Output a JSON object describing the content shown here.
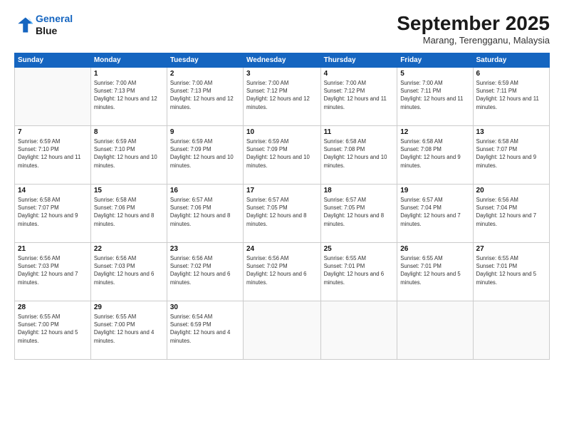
{
  "logo": {
    "line1": "General",
    "line2": "Blue"
  },
  "title": "September 2025",
  "subtitle": "Marang, Terengganu, Malaysia",
  "weekdays": [
    "Sunday",
    "Monday",
    "Tuesday",
    "Wednesday",
    "Thursday",
    "Friday",
    "Saturday"
  ],
  "weeks": [
    [
      {
        "day": "",
        "empty": true
      },
      {
        "day": "1",
        "sunrise": "7:00 AM",
        "sunset": "7:13 PM",
        "daylight": "12 hours and 12 minutes."
      },
      {
        "day": "2",
        "sunrise": "7:00 AM",
        "sunset": "7:13 PM",
        "daylight": "12 hours and 12 minutes."
      },
      {
        "day": "3",
        "sunrise": "7:00 AM",
        "sunset": "7:12 PM",
        "daylight": "12 hours and 12 minutes."
      },
      {
        "day": "4",
        "sunrise": "7:00 AM",
        "sunset": "7:12 PM",
        "daylight": "12 hours and 11 minutes."
      },
      {
        "day": "5",
        "sunrise": "7:00 AM",
        "sunset": "7:11 PM",
        "daylight": "12 hours and 11 minutes."
      },
      {
        "day": "6",
        "sunrise": "6:59 AM",
        "sunset": "7:11 PM",
        "daylight": "12 hours and 11 minutes."
      }
    ],
    [
      {
        "day": "7",
        "sunrise": "6:59 AM",
        "sunset": "7:10 PM",
        "daylight": "12 hours and 11 minutes."
      },
      {
        "day": "8",
        "sunrise": "6:59 AM",
        "sunset": "7:10 PM",
        "daylight": "12 hours and 10 minutes."
      },
      {
        "day": "9",
        "sunrise": "6:59 AM",
        "sunset": "7:09 PM",
        "daylight": "12 hours and 10 minutes."
      },
      {
        "day": "10",
        "sunrise": "6:59 AM",
        "sunset": "7:09 PM",
        "daylight": "12 hours and 10 minutes."
      },
      {
        "day": "11",
        "sunrise": "6:58 AM",
        "sunset": "7:08 PM",
        "daylight": "12 hours and 10 minutes."
      },
      {
        "day": "12",
        "sunrise": "6:58 AM",
        "sunset": "7:08 PM",
        "daylight": "12 hours and 9 minutes."
      },
      {
        "day": "13",
        "sunrise": "6:58 AM",
        "sunset": "7:07 PM",
        "daylight": "12 hours and 9 minutes."
      }
    ],
    [
      {
        "day": "14",
        "sunrise": "6:58 AM",
        "sunset": "7:07 PM",
        "daylight": "12 hours and 9 minutes."
      },
      {
        "day": "15",
        "sunrise": "6:58 AM",
        "sunset": "7:06 PM",
        "daylight": "12 hours and 8 minutes."
      },
      {
        "day": "16",
        "sunrise": "6:57 AM",
        "sunset": "7:06 PM",
        "daylight": "12 hours and 8 minutes."
      },
      {
        "day": "17",
        "sunrise": "6:57 AM",
        "sunset": "7:05 PM",
        "daylight": "12 hours and 8 minutes."
      },
      {
        "day": "18",
        "sunrise": "6:57 AM",
        "sunset": "7:05 PM",
        "daylight": "12 hours and 8 minutes."
      },
      {
        "day": "19",
        "sunrise": "6:57 AM",
        "sunset": "7:04 PM",
        "daylight": "12 hours and 7 minutes."
      },
      {
        "day": "20",
        "sunrise": "6:56 AM",
        "sunset": "7:04 PM",
        "daylight": "12 hours and 7 minutes."
      }
    ],
    [
      {
        "day": "21",
        "sunrise": "6:56 AM",
        "sunset": "7:03 PM",
        "daylight": "12 hours and 7 minutes."
      },
      {
        "day": "22",
        "sunrise": "6:56 AM",
        "sunset": "7:03 PM",
        "daylight": "12 hours and 6 minutes."
      },
      {
        "day": "23",
        "sunrise": "6:56 AM",
        "sunset": "7:02 PM",
        "daylight": "12 hours and 6 minutes."
      },
      {
        "day": "24",
        "sunrise": "6:56 AM",
        "sunset": "7:02 PM",
        "daylight": "12 hours and 6 minutes."
      },
      {
        "day": "25",
        "sunrise": "6:55 AM",
        "sunset": "7:01 PM",
        "daylight": "12 hours and 6 minutes."
      },
      {
        "day": "26",
        "sunrise": "6:55 AM",
        "sunset": "7:01 PM",
        "daylight": "12 hours and 5 minutes."
      },
      {
        "day": "27",
        "sunrise": "6:55 AM",
        "sunset": "7:01 PM",
        "daylight": "12 hours and 5 minutes."
      }
    ],
    [
      {
        "day": "28",
        "sunrise": "6:55 AM",
        "sunset": "7:00 PM",
        "daylight": "12 hours and 5 minutes."
      },
      {
        "day": "29",
        "sunrise": "6:55 AM",
        "sunset": "7:00 PM",
        "daylight": "12 hours and 4 minutes."
      },
      {
        "day": "30",
        "sunrise": "6:54 AM",
        "sunset": "6:59 PM",
        "daylight": "12 hours and 4 minutes."
      },
      {
        "day": "",
        "empty": true
      },
      {
        "day": "",
        "empty": true
      },
      {
        "day": "",
        "empty": true
      },
      {
        "day": "",
        "empty": true
      }
    ]
  ]
}
